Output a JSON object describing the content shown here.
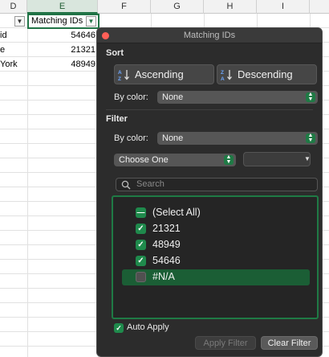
{
  "sheet": {
    "columns": [
      "D",
      "E",
      "F",
      "G",
      "H",
      "I"
    ],
    "header_cell": "Matching IDs",
    "rows": [
      {
        "d": "id",
        "e": "54646"
      },
      {
        "d": "e",
        "e": "21321"
      },
      {
        "d": "York",
        "e": "48949"
      }
    ]
  },
  "panel": {
    "title": "Matching IDs",
    "sort": {
      "title": "Sort",
      "ascending_label": "Ascending",
      "descending_label": "Descending",
      "by_color_label": "By color:",
      "by_color_value": "None"
    },
    "filter": {
      "title": "Filter",
      "by_color_label": "By color:",
      "by_color_value": "None",
      "condition_value": "Choose One",
      "condition_input_value": "",
      "search_placeholder": "Search"
    },
    "list": [
      {
        "label": "(Select All)",
        "state": "mixed"
      },
      {
        "label": "21321",
        "state": "checked"
      },
      {
        "label": "48949",
        "state": "checked"
      },
      {
        "label": "54646",
        "state": "checked"
      },
      {
        "label": "#N/A",
        "state": "unchecked"
      }
    ],
    "auto_apply_label": "Auto Apply",
    "auto_apply_checked": true,
    "apply_filter_label": "Apply Filter",
    "clear_filter_label": "Clear Filter"
  },
  "colors": {
    "accent_green": "#1f7a45",
    "highlight_green": "#1b5e35",
    "panel_bg": "#2c2c2c",
    "close_red": "#ff5f57"
  }
}
